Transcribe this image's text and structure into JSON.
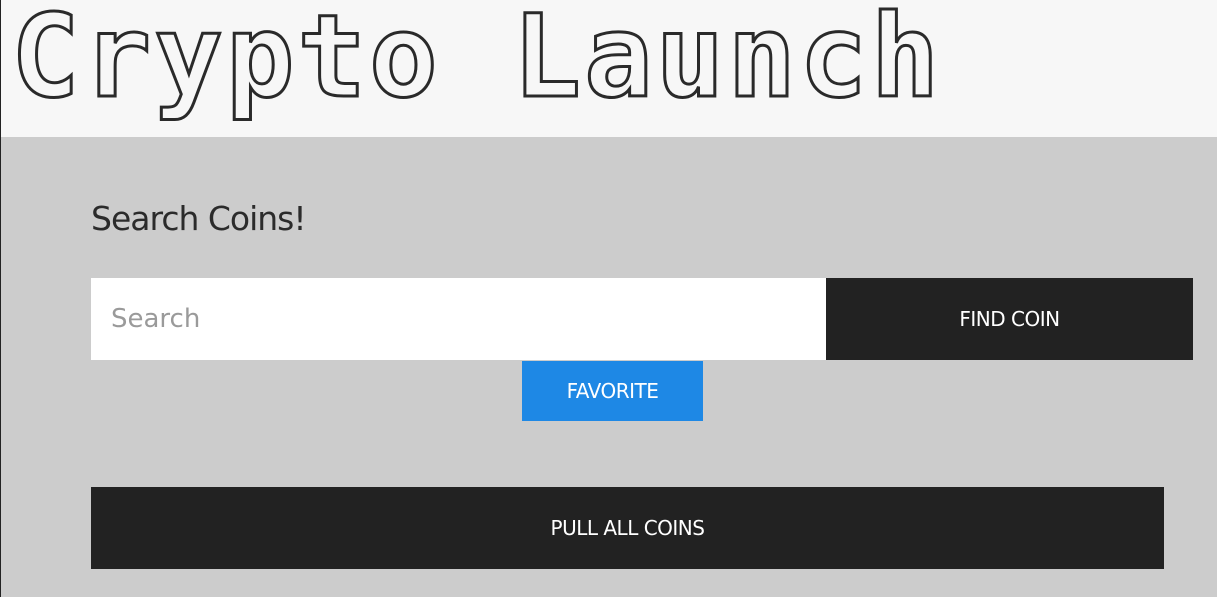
{
  "header": {
    "title": "Crypto Launch"
  },
  "search": {
    "heading": "Search Coins!",
    "placeholder": "Search",
    "value": "",
    "find_label": "FIND COIN",
    "favorite_label": "FAVORITE"
  },
  "actions": {
    "pull_all_label": "PULL ALL COINS"
  },
  "colors": {
    "header_bg": "#f7f7f7",
    "page_bg": "#cccccc",
    "dark_button": "#222222",
    "accent_blue": "#1e88e5"
  }
}
